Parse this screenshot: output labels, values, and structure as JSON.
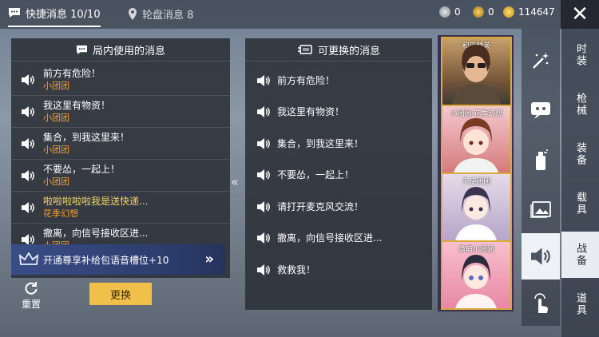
{
  "tabs": {
    "quick": "快捷消息 10/10",
    "wheel": "轮盘消息 8"
  },
  "currency": {
    "c1": "0",
    "c2": "0",
    "c3": "114647"
  },
  "left_panel": {
    "title": "局内使用的消息",
    "rows": [
      {
        "text": "前方有危险！",
        "sub": "小团团"
      },
      {
        "text": "我这里有物资！",
        "sub": "小团团"
      },
      {
        "text": "集合，到我这里来！",
        "sub": "小团团"
      },
      {
        "text": "不要怂，一起上！",
        "sub": "小团团"
      },
      {
        "text": "啦啦啦啦啦我是送快递...",
        "sub": "花季幻想"
      },
      {
        "text": "撤离，向信号接收区进...",
        "sub": "小团团"
      }
    ]
  },
  "promo": {
    "text": "开通尊享补给包语音槽位+10"
  },
  "actions": {
    "reset": "重置",
    "replace": "更换"
  },
  "right_panel": {
    "title": "可更换的消息",
    "rows": [
      "前方有危险！",
      "我这里有物资！",
      "集合，到我这里来！",
      "不要怂，一起上！",
      "请打开麦克风交流！",
      "撤离，向信号接收区进...",
      "救救我！"
    ]
  },
  "cards": [
    {
      "caption": "和平精英"
    },
    {
      "caption": "小团团·花季幻想"
    },
    {
      "caption": "天使团团"
    },
    {
      "caption": "激萌小团团"
    }
  ],
  "side_tabs": [
    "时装",
    "枪械",
    "装备",
    "载具",
    "战备",
    "道具"
  ],
  "colors": {
    "accent_orange": "#f0a030",
    "button_yellow": "#f1c04a",
    "card_border": "#d9a93a",
    "active_tab_bg": "#e9edf2"
  }
}
